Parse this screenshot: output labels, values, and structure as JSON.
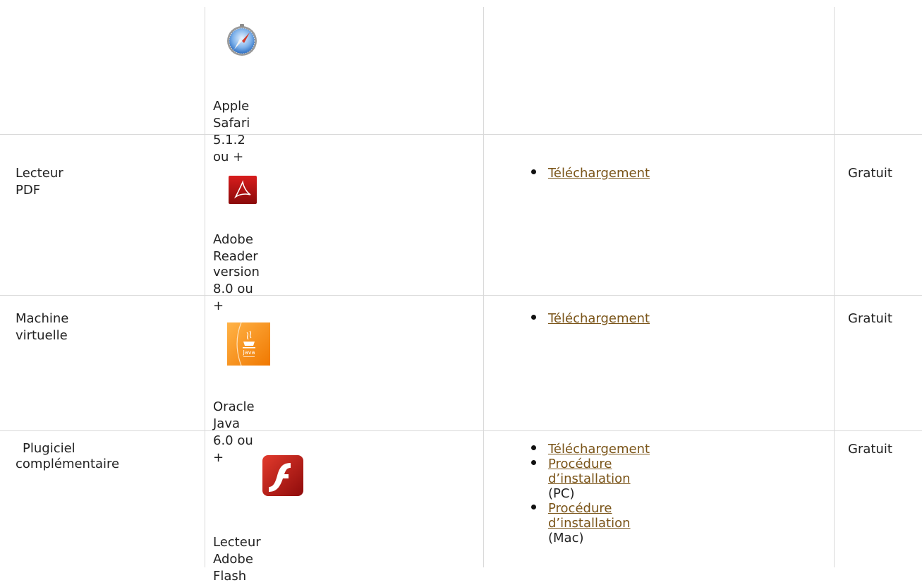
{
  "rows": [
    {
      "category": "",
      "software": [
        "Apple Safari 5.1.2 ou +"
      ],
      "icon": "safari-compass-icon",
      "links": [],
      "price": ""
    },
    {
      "category": "Lecteur PDF",
      "software": [
        "Adobe Reader",
        "version 8.0 ou +"
      ],
      "icon": "adobe-reader-icon",
      "links": [
        {
          "text": "Téléchargement",
          "suffix": ""
        }
      ],
      "price": "Gratuit"
    },
    {
      "category": "Machine virtuelle",
      "software": [
        "Oracle Java 6.0 ou +"
      ],
      "icon": "java-icon",
      "links": [
        {
          "text": "Téléchargement",
          "suffix": ""
        }
      ],
      "price": "Gratuit"
    },
    {
      "category": "Plugiciel complémentaire",
      "category_lines": [
        "Plugiciel",
        "complémentaire"
      ],
      "software": [
        "Lecteur Adobe Flash"
      ],
      "icon": "adobe-flash-icon",
      "links": [
        {
          "text": "Téléchargement",
          "suffix": ""
        },
        {
          "text": "Procédure d’installation",
          "suffix": "(PC)"
        },
        {
          "text": "Procédure d’installation",
          "suffix": "(Mac)"
        }
      ],
      "price": "Gratuit"
    }
  ],
  "colors": {
    "link": "#7a5418",
    "border": "#d9d9d9",
    "text": "#222222"
  }
}
